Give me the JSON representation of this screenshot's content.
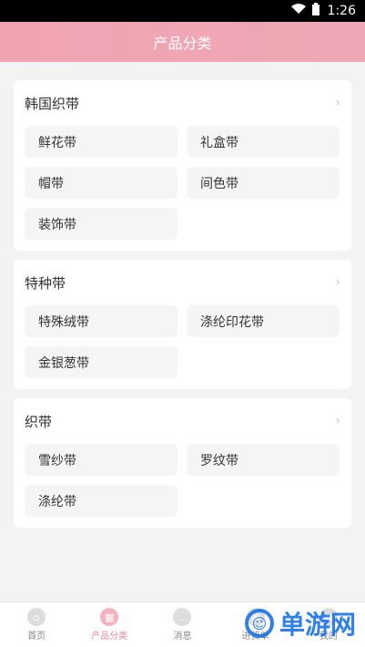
{
  "status_bar": {
    "time": "1:26"
  },
  "header": {
    "title": "产品分类"
  },
  "sections": [
    {
      "title": "韩国织带",
      "items": [
        "鲜花带",
        "礼盒带",
        "帽带",
        "间色带",
        "装饰带"
      ]
    },
    {
      "title": "特种带",
      "items": [
        "特殊绒带",
        "涤纶印花带",
        "金银葱带"
      ]
    },
    {
      "title": "织带",
      "items": [
        "雪纱带",
        "罗纹带",
        "涤纶带"
      ]
    }
  ],
  "bottom_nav": [
    {
      "label": "首页",
      "icon": "home-icon"
    },
    {
      "label": "产品分类",
      "icon": "grid-icon"
    },
    {
      "label": "消息",
      "icon": "message-icon"
    },
    {
      "label": "进货单",
      "icon": "cart-icon"
    },
    {
      "label": "我的",
      "icon": "user-icon"
    }
  ],
  "watermark": {
    "text": "单游网",
    "icon": "logo-icon"
  }
}
